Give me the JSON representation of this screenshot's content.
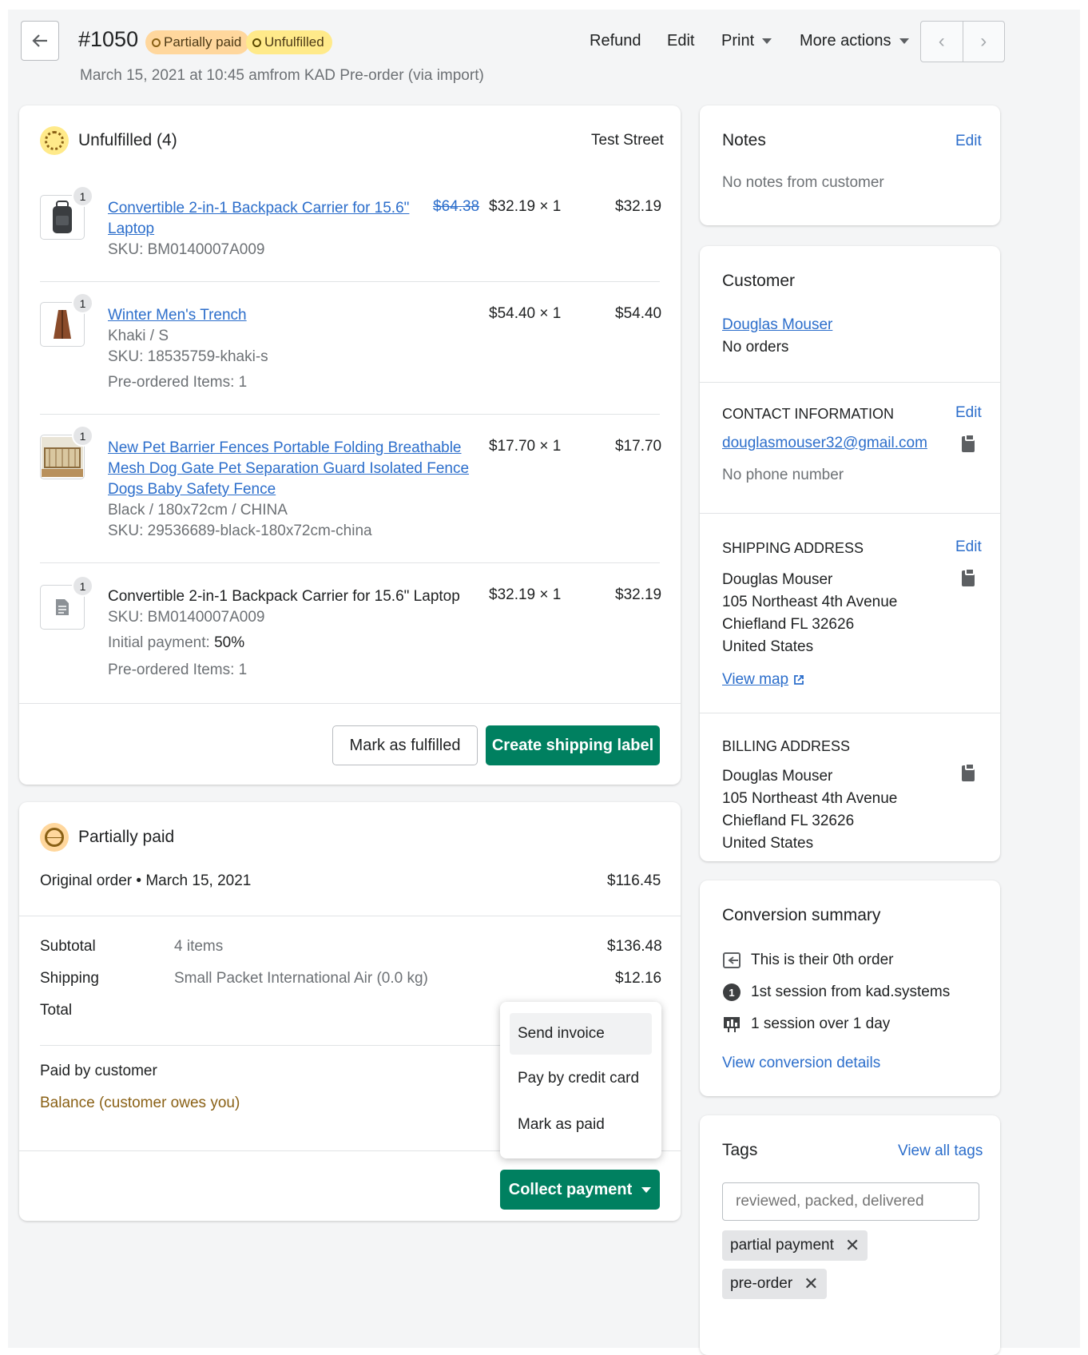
{
  "header": {
    "order_number": "#1050",
    "badge_payment": "Partially paid",
    "badge_fulfillment": "Unfulfilled",
    "subtitle": "March 15, 2021 at 10:45 amfrom KAD Pre-order (via import)",
    "actions": {
      "refund": "Refund",
      "edit": "Edit",
      "print": "Print",
      "more": "More actions"
    }
  },
  "unfulfilled": {
    "title": "Unfulfilled (4)",
    "location": "Test Street",
    "items": [
      {
        "qty": "1",
        "title_line1": "Convertible 2-in-1 Backpack Carrier for 15.6\"",
        "title_line2": "Laptop",
        "original_price": "$64.38",
        "unit": "$32.19 × 1",
        "total": "$32.19",
        "sku": "SKU: BM0140007A009"
      },
      {
        "qty": "1",
        "title": "Winter Men's Trench",
        "variant": "Khaki / S",
        "sku": "SKU: 18535759-khaki-s",
        "preorder": "Pre-ordered Items: 1",
        "unit": "$54.40 × 1",
        "total": "$54.40"
      },
      {
        "qty": "1",
        "title_line1": "New Pet Barrier Fences Portable Folding Breathable",
        "title_line2": "Mesh Dog Gate Pet Separation Guard Isolated Fence",
        "title_line3": "Dogs Baby Safety Fence",
        "variant": "Black / 180x72cm / CHINA",
        "sku": "SKU: 29536689-black-180x72cm-china",
        "unit": "$17.70 × 1",
        "total": "$17.70"
      },
      {
        "qty": "1",
        "title": "Convertible 2-in-1 Backpack Carrier for 15.6\" Laptop",
        "sku": "SKU: BM0140007A009",
        "initial_label": "Initial payment: ",
        "initial_value": "50%",
        "preorder": "Pre-ordered Items: 1",
        "unit": "$32.19 × 1",
        "total": "$32.19"
      }
    ],
    "mark_fulfilled": "Mark as fulfilled",
    "create_label": "Create shipping label"
  },
  "payment": {
    "title": "Partially paid",
    "original_order": "Original order • March 15, 2021",
    "original_amount": "$116.45",
    "subtotal_label": "Subtotal",
    "subtotal_desc": "4 items",
    "subtotal_value": "$136.48",
    "shipping_label": "Shipping",
    "shipping_desc": "Small Packet International Air (0.0 kg)",
    "shipping_value": "$12.16",
    "total_label": "Total",
    "paid_label": "Paid by customer",
    "balance_label": "Balance (customer owes you)",
    "collect": "Collect payment",
    "menu": [
      "Send invoice",
      "Pay by credit card",
      "Mark as paid"
    ]
  },
  "notes": {
    "title": "Notes",
    "edit": "Edit",
    "text": "No notes from customer"
  },
  "customer": {
    "title": "Customer",
    "name": "Douglas Mouser",
    "orders": "No orders",
    "contact_title": "CONTACT INFORMATION",
    "contact_edit": "Edit",
    "email": "douglasmouser32@gmail.com",
    "phone": "No phone number",
    "shipping_title": "SHIPPING ADDRESS",
    "shipping_edit": "Edit",
    "shipping_lines": [
      "Douglas Mouser",
      "105 Northeast 4th Avenue",
      "Chiefland FL 32626",
      "United States"
    ],
    "view_map": "View map",
    "billing_title": "BILLING ADDRESS",
    "billing_lines": [
      "Douglas Mouser",
      "105 Northeast 4th Avenue",
      "Chiefland FL 32626",
      "United States"
    ]
  },
  "conversion": {
    "title": "Conversion summary",
    "rows": [
      "This is their 0th order",
      "1st session from kad.systems",
      "1 session over 1 day"
    ],
    "link": "View conversion details"
  },
  "tags": {
    "title": "Tags",
    "view_all": "View all tags",
    "placeholder": "reviewed, packed, delivered",
    "items": [
      "partial payment",
      "pre-order"
    ]
  },
  "colors": {
    "primary": "#008060",
    "link": "#2c6ecb",
    "badge_payment": "#ffd79d",
    "badge_fulfillment": "#ffea8a",
    "balance": "#8a6116"
  }
}
